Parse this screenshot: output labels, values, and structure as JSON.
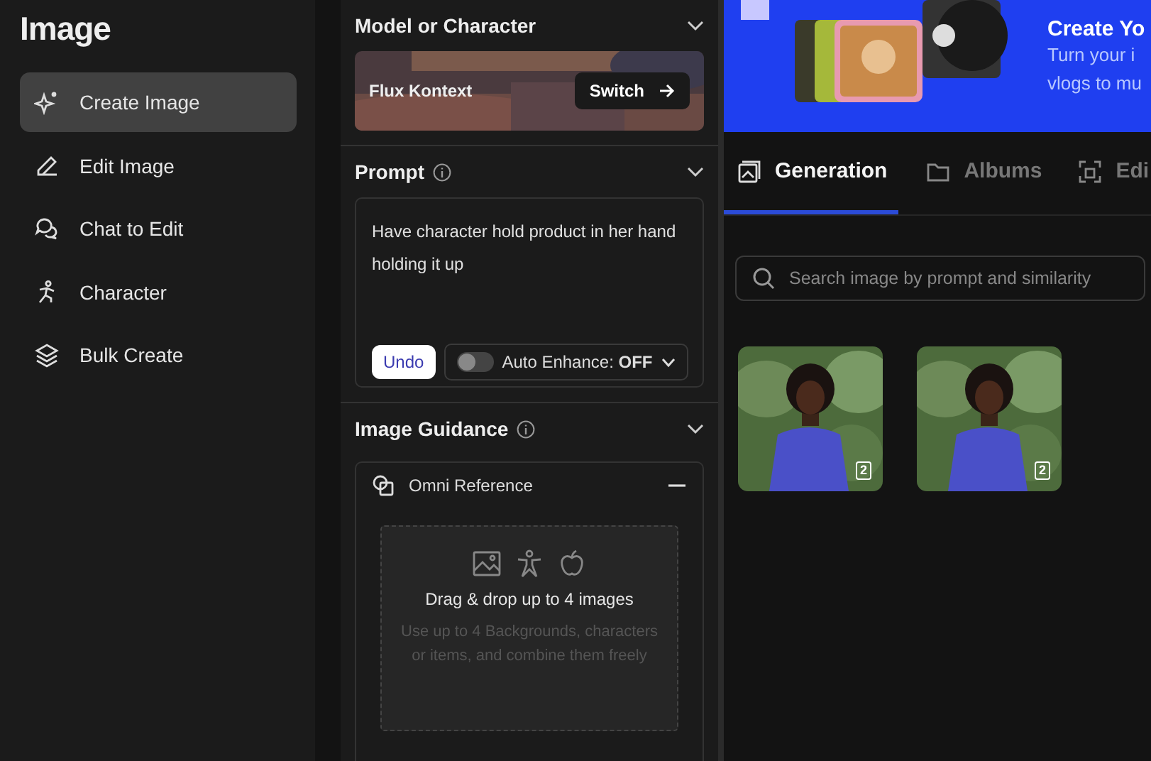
{
  "sidebar": {
    "title": "Image",
    "items": [
      {
        "label": "Create Image",
        "selected": true
      },
      {
        "label": "Edit Image",
        "selected": false
      },
      {
        "label": "Chat to Edit",
        "selected": false
      },
      {
        "label": "Character",
        "selected": false
      },
      {
        "label": "Bulk Create",
        "selected": false
      }
    ]
  },
  "model": {
    "title": "Model or Character",
    "name": "Flux Kontext",
    "button": "Switch"
  },
  "prompt": {
    "title": "Prompt",
    "value": "Have character hold product in her hand holding it up",
    "undo": "Undo",
    "enhance": {
      "label": "Auto Enhance: **OFF**",
      "on": false
    }
  },
  "guidance": {
    "title": "Image Guidance",
    "section": "Omni Reference",
    "drop_title": "Drag & drop up to 4 images",
    "drop_hint": "Use up to 4 Backgrounds, characters or items, and combine them freely"
  },
  "banner": {
    "title": "Create Yo",
    "lines": [
      "Turn your i",
      "vlogs to mu"
    ]
  },
  "tabs": [
    {
      "label": "Generation",
      "selected": true
    },
    {
      "label": "Albums",
      "selected": false
    },
    {
      "label": "Edi",
      "selected": false
    }
  ],
  "search": {
    "placeholder": "Search image by prompt and similarity"
  },
  "results": [
    {
      "kind": "picture",
      "badge": "2"
    },
    {
      "kind": "picture",
      "badge": "2"
    }
  ]
}
